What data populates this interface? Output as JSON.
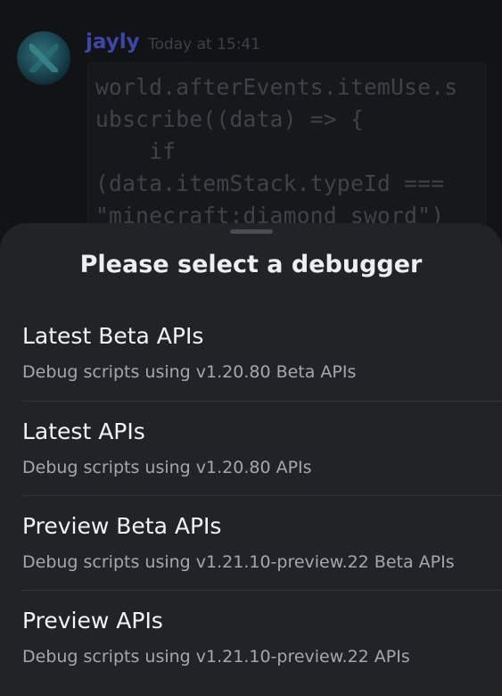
{
  "background_message": {
    "author": "jayly",
    "timestamp": "Today at 15:41",
    "code_lines": [
      "world.afterEvents.itemUse.s",
      "ubscribe((data) => {",
      "    if",
      "(data.itemStack.typeId ===",
      "\"minecraft:diamond_sword\")"
    ]
  },
  "sheet": {
    "title": "Please select a debugger",
    "options": [
      {
        "label": "Latest Beta APIs",
        "description": "Debug scripts using v1.20.80 Beta APIs"
      },
      {
        "label": "Latest APIs",
        "description": "Debug scripts using v1.20.80 APIs"
      },
      {
        "label": "Preview Beta APIs",
        "description": "Debug scripts using v1.21.10-preview.22 Beta APIs"
      },
      {
        "label": "Preview APIs",
        "description": "Debug scripts using v1.21.10-preview.22 APIs"
      }
    ]
  },
  "colors": {
    "author": "#3f47a4",
    "sheet_background": "#222327",
    "title": "#eceef1",
    "description": "#a4a7ae"
  }
}
